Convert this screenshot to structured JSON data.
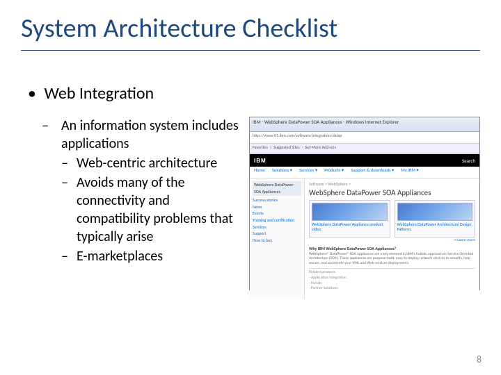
{
  "title": "System Architecture Checklist",
  "bullet_l1": "Web Integration",
  "sub": {
    "item1": "An information system includes applications",
    "item2": "Web-centric architecture",
    "item3": "Avoids many of the connectivity and compatibility problems that typically arise",
    "item4": "E-marketplaces"
  },
  "figure": {
    "window_title": "IBM - WebSphere DataPower SOA Appliances - Windows Internet Explorer",
    "url": "http://www-01.ibm.com/software/integration/datap",
    "fav_label": "Favorites",
    "suggested": "Suggested Sites",
    "more_addons": "Get More Add-ons",
    "ibm_logo": "IBM",
    "ibm_search": "Search",
    "nav": {
      "home": "Home",
      "solutions": "Solutions ▾",
      "services": "Services ▾",
      "products": "Products ▾",
      "support": "Support & downloads ▾",
      "myibm": "My IBM ▾"
    },
    "sidebar": {
      "header": "WebSphere DataPower SOA Appliances",
      "i1": "Success stories",
      "i2": "News",
      "i3": "Events",
      "i4": "Training and certification",
      "i5": "Services",
      "i6": "Support",
      "i7": "How to buy"
    },
    "breadcrumb": "Software > WebSphere >",
    "page_h1": "WebSphere DataPower SOA Appliances",
    "card1": "WebSphere DataPower Appliance product video",
    "card2": "WebSphere DataPower Architectural Design Patterns",
    "learn_more": "→ Learn more",
    "desc_head": "Why IBM WebSphere DataPower SOA Appliances?",
    "desc_body": "WebSphere® DataPower® SOA appliances are a key element in IBM's holistic approach to Service Oriented Architecture (SOA). These appliances are purpose-built, easy-to-deploy network devices to simplify, help secure, and accelerate your XML and Web services deployments.",
    "related_h": "Related products",
    "rel1": "- Application integration",
    "rel2": "- Portals",
    "rel3": "- Partner Solutions"
  },
  "page_number": "8"
}
